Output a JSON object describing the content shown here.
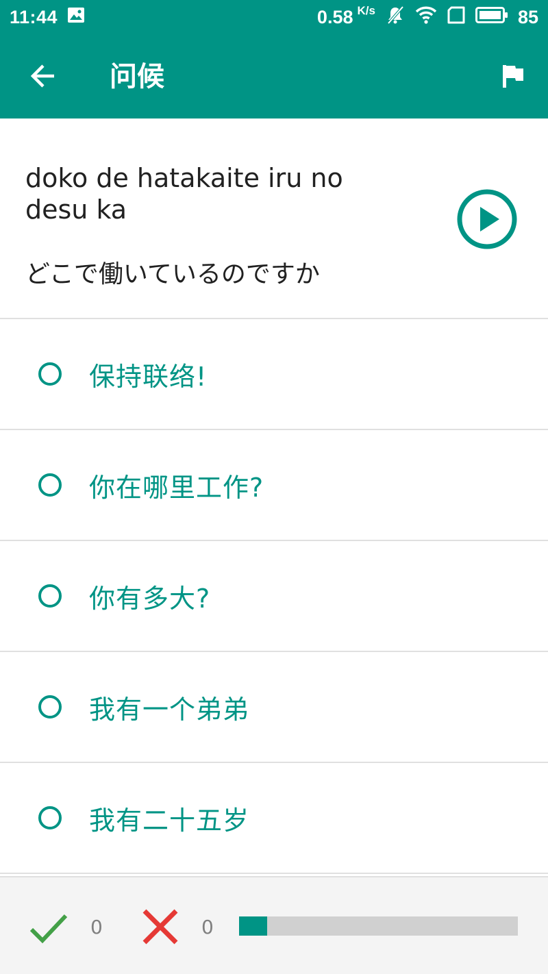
{
  "status_bar": {
    "time": "11:44",
    "net_speed": "0.58",
    "net_speed_unit": "K/s",
    "battery": "85",
    "icons": [
      "image-icon",
      "mute-icon",
      "wifi-icon",
      "sim-icon",
      "battery-icon"
    ]
  },
  "app_bar": {
    "title": "问候",
    "back_icon": "arrow-left-icon",
    "flag_icon": "flag-icon",
    "background_color": "#009485"
  },
  "question": {
    "romaji": "doko de hatakaite iru no desu ka",
    "japanese": "どこで働いているのですか",
    "play_icon": "play-circle-icon"
  },
  "options": [
    {
      "label": "保持联络!"
    },
    {
      "label": "你在哪里工作?"
    },
    {
      "label": "你有多大?"
    },
    {
      "label": "我有一个弟弟"
    },
    {
      "label": "我有二十五岁"
    }
  ],
  "footer": {
    "correct_count": "0",
    "wrong_count": "0",
    "progress_fraction": 0.1,
    "correct_color": "#43a047",
    "wrong_color": "#e53935",
    "accent_color": "#009485"
  }
}
